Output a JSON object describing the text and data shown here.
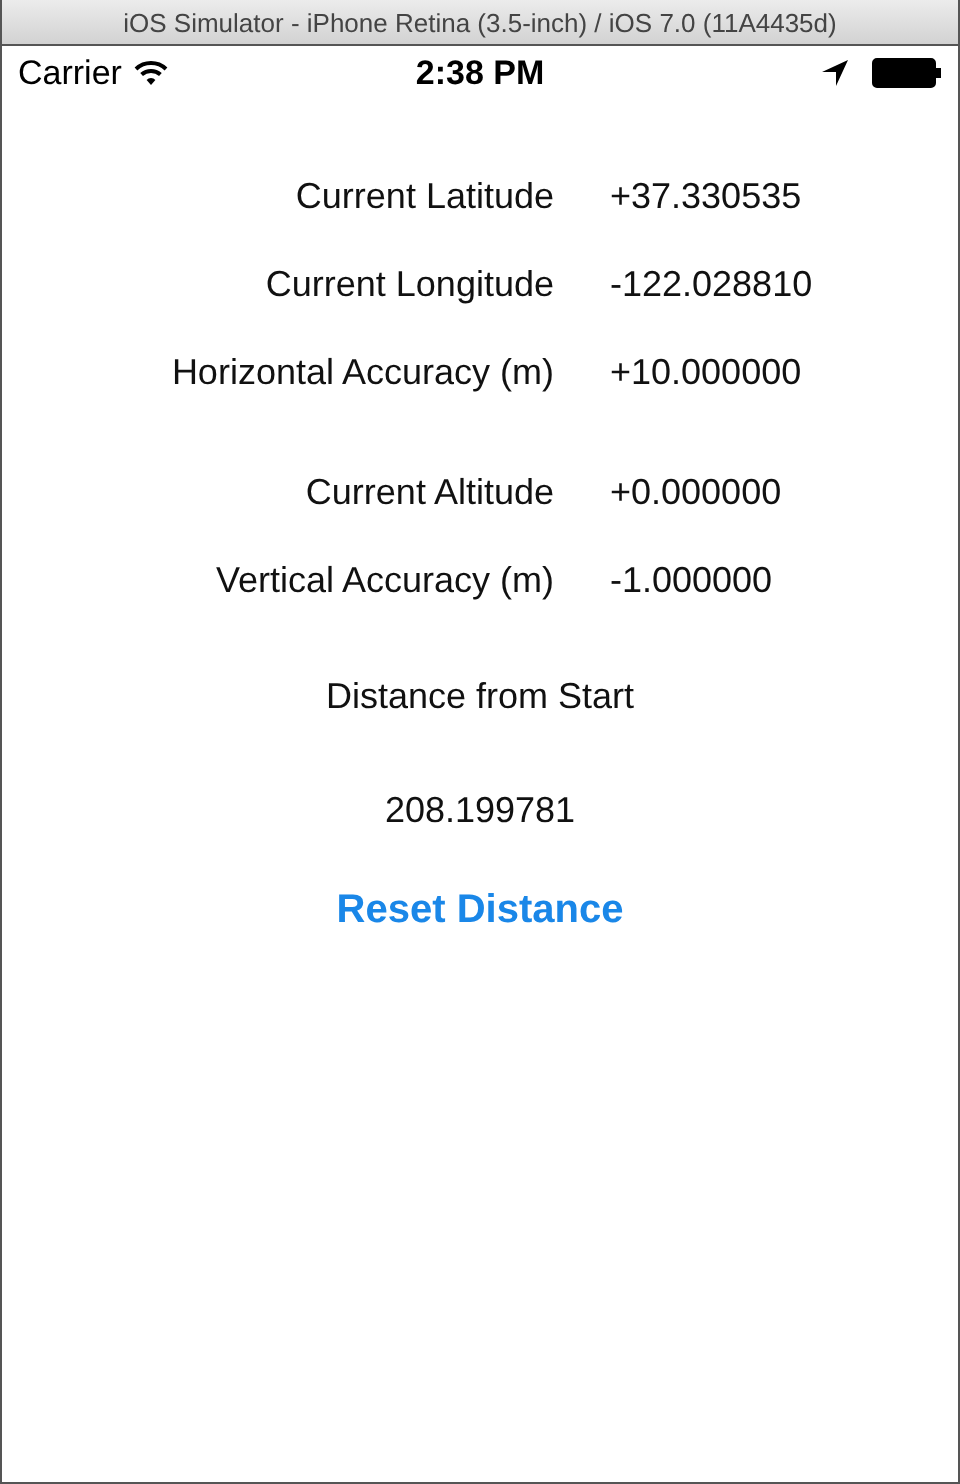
{
  "window": {
    "title": "iOS Simulator - iPhone Retina (3.5-inch) / iOS 7.0 (11A4435d)"
  },
  "status_bar": {
    "carrier": "Carrier",
    "time": "2:38 PM"
  },
  "groups": [
    {
      "rows": [
        {
          "label": "Current Latitude",
          "value": "+37.330535"
        },
        {
          "label": "Current Longitude",
          "value": "-122.028810"
        },
        {
          "label": "Horizontal Accuracy (m)",
          "value": "+10.000000"
        }
      ]
    },
    {
      "rows": [
        {
          "label": "Current Altitude",
          "value": "+0.000000"
        },
        {
          "label": "Vertical Accuracy (m)",
          "value": "-1.000000"
        }
      ]
    }
  ],
  "distance": {
    "label": "Distance from Start",
    "value": "208.199781"
  },
  "reset_button": "Reset Distance"
}
